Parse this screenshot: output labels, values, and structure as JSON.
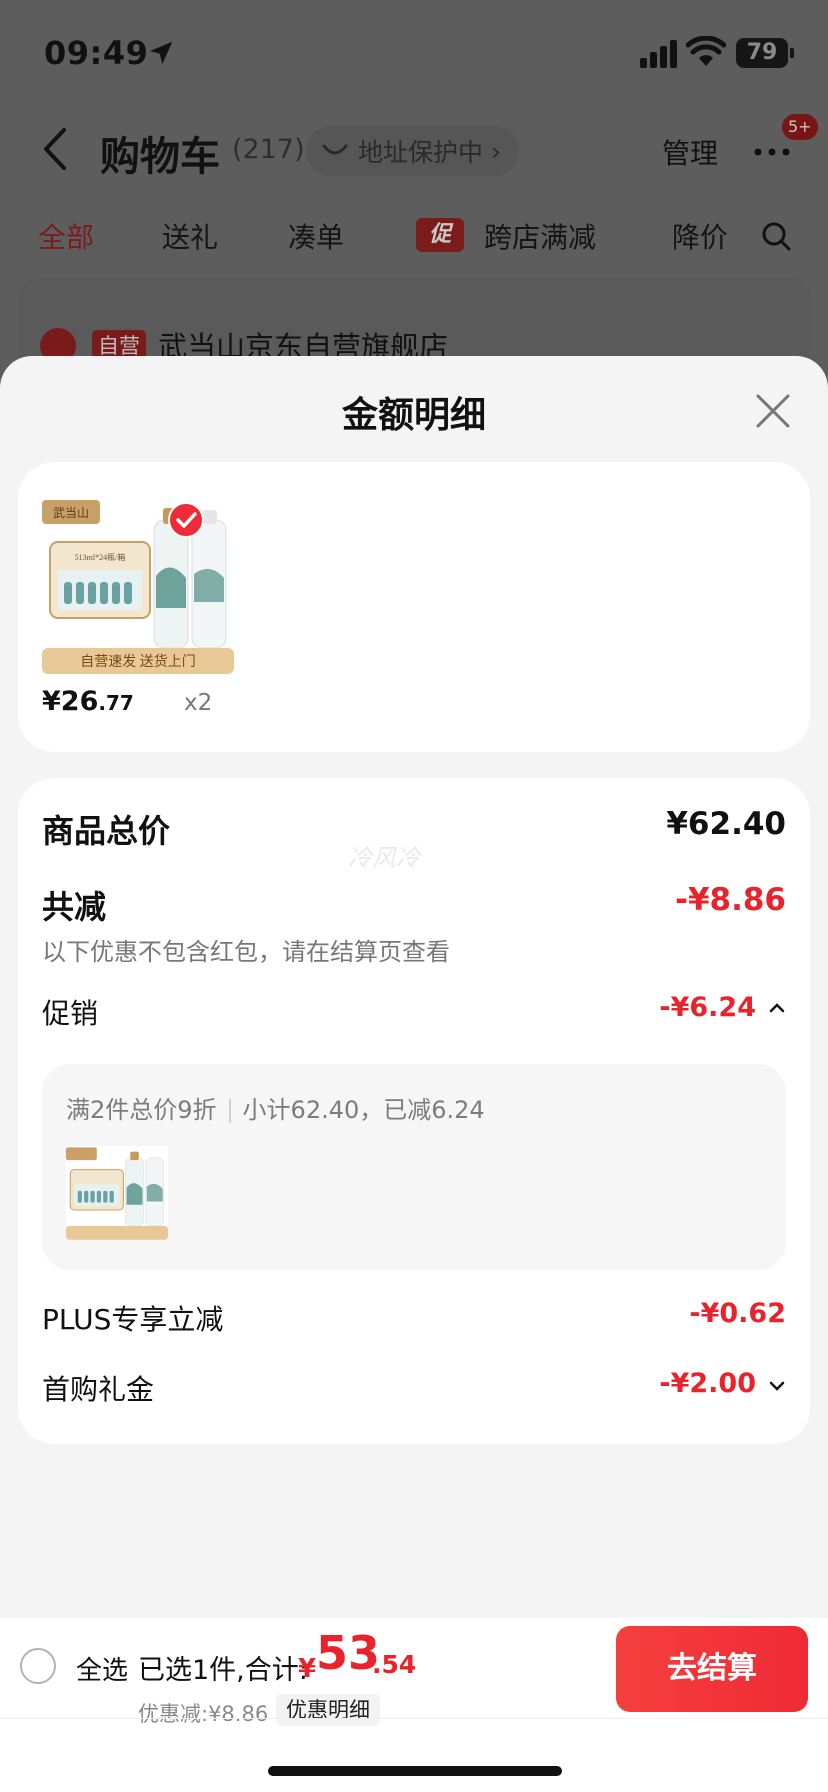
{
  "status_bar": {
    "time": "09:49",
    "battery": "79"
  },
  "nav": {
    "title": "购物车",
    "count": "(217)",
    "address_protect": "地址保护中",
    "manage": "管理",
    "badge": "5+"
  },
  "tabs": [
    {
      "label": "全部"
    },
    {
      "label": "送礼"
    },
    {
      "label": "凑单"
    },
    {
      "label": "跨店满减",
      "tag": "促"
    },
    {
      "label": "降价"
    }
  ],
  "store": {
    "tag": "自营",
    "name": "武当山京东自营旗舰店"
  },
  "sheet": {
    "title": "金额明细",
    "product": {
      "price_int": "¥26",
      "price_dec": ".77",
      "qty": "x2",
      "image_text": {
        "brand": "武当山",
        "spec": "513ml*24瓶/箱",
        "banner": "自营速发  送货上门"
      }
    },
    "watermark": "冷风冷",
    "summary": {
      "goods_total_label": "商品总价",
      "goods_total_value": "¥62.40",
      "total_discount_label": "共减",
      "total_discount_value": "-¥8.86",
      "note": "以下优惠不包含红包，请在结算页查看",
      "promo_label": "促销",
      "promo_value": "-¥6.24",
      "promo_rule": "满2件总价9折",
      "promo_detail": "小计62.40，已减6.24",
      "plus_label": "PLUS专享立减",
      "plus_value": "-¥0.62",
      "first_label": "首购礼金",
      "first_value": "-¥2.00"
    }
  },
  "bottom": {
    "select_all": "全选",
    "selected": "已选1件,合计:",
    "yen": "¥",
    "total_int": "53",
    "total_dec": ".54",
    "discount": "优惠减:¥8.86",
    "detail_btn": "优惠明细",
    "checkout": "去结算"
  },
  "colors": {
    "accent": "#e8232b",
    "sheet_bg": "#f4f4f4",
    "card_bg": "#ffffff"
  }
}
